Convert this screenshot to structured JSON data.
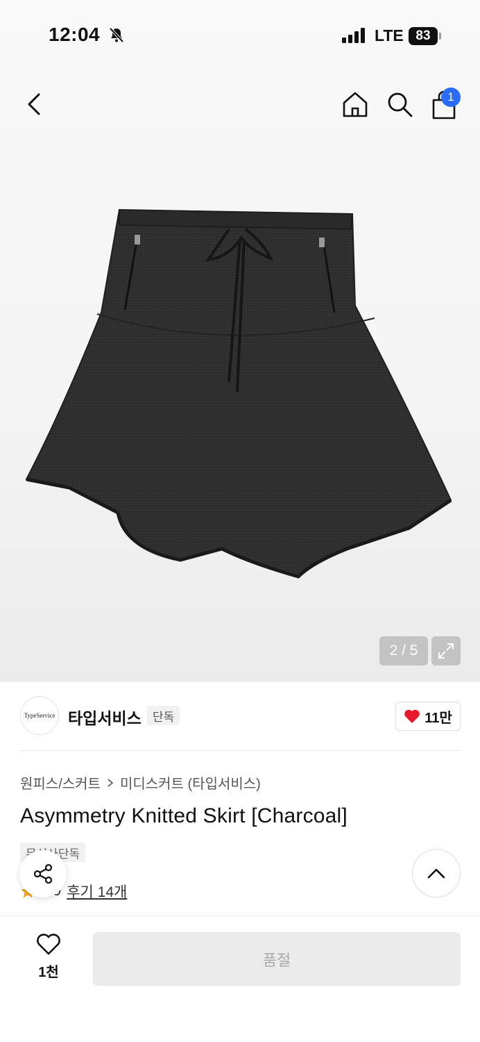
{
  "status_bar": {
    "time": "12:04",
    "network": "LTE",
    "battery": "83"
  },
  "nav": {
    "cart_count": "1"
  },
  "gallery": {
    "counter": "2 / 5"
  },
  "brand": {
    "logo_text": "TypeService",
    "name": "타입서비스",
    "tag": "단독",
    "likes": "11만"
  },
  "product": {
    "breadcrumb": [
      "원피스/스커트",
      "미디스커트 (타입서비스)"
    ],
    "title": "Asymmetry Knitted Skirt [Charcoal]",
    "badge": "무신사단독",
    "rating": "4.9",
    "reviews": "후기 14개"
  },
  "bottom": {
    "wish_count": "1천",
    "soldout_label": "품절"
  },
  "colors": {
    "accent": "#2b6cf6",
    "heart": "#e8192c",
    "star": "#f5a623",
    "skirt": "#2e2e2e"
  }
}
